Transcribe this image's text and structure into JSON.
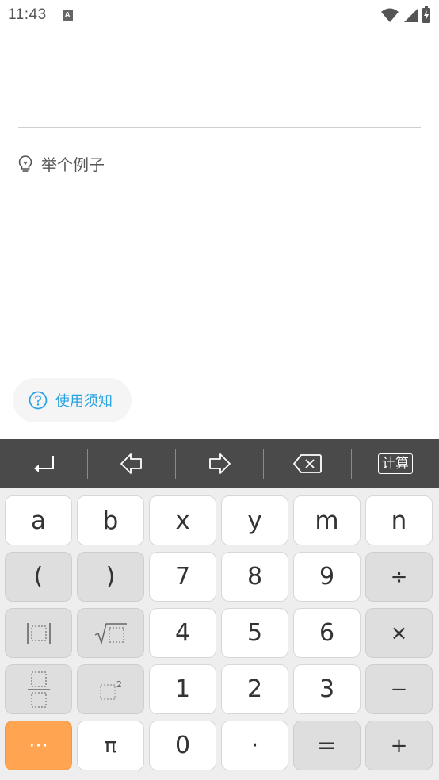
{
  "status": {
    "time": "11:43",
    "notif_icon": "A"
  },
  "example": {
    "label": "举个例子"
  },
  "notice": {
    "label": "使用须知"
  },
  "toolbar": {
    "calc_label": "计算"
  },
  "keypad": {
    "row1": [
      "a",
      "b",
      "x",
      "y",
      "m",
      "n"
    ],
    "row2": [
      "(",
      ")",
      "7",
      "8",
      "9",
      "÷"
    ],
    "row3": [
      "",
      "",
      "4",
      "5",
      "6",
      "×"
    ],
    "row4": [
      "",
      "",
      "1",
      "2",
      "3",
      "−"
    ],
    "row5": [
      "···",
      "π",
      "0",
      "·",
      "=",
      "+"
    ],
    "power_exponent": "2"
  }
}
